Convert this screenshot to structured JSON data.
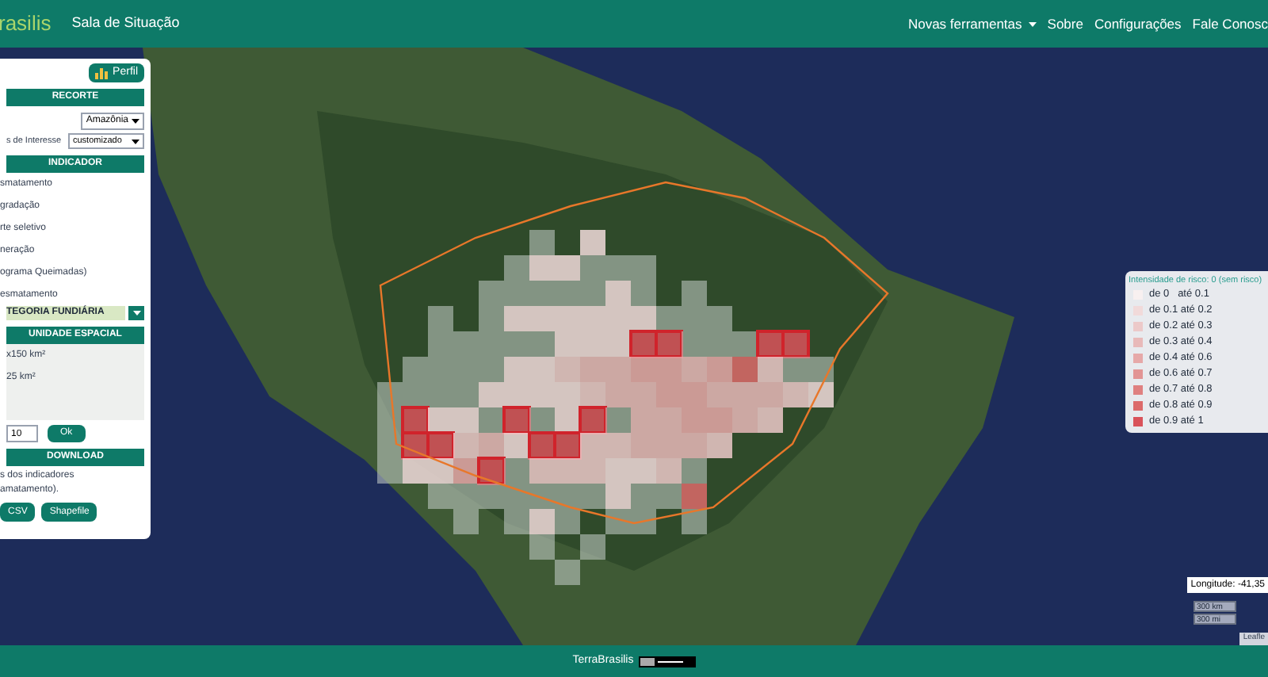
{
  "header": {
    "logo": "rasilis",
    "title": "Sala de Situação",
    "nav": [
      {
        "label": "Novas ferramentas",
        "kind": "dropdown"
      },
      {
        "label": "Sobre",
        "kind": "link"
      },
      {
        "label": "Configurações",
        "kind": "link"
      },
      {
        "label": "Fale Conosc",
        "kind": "link"
      }
    ]
  },
  "panel": {
    "profile_button": "Perfil",
    "sections": [
      {
        "kind": "recorte",
        "title": "RECORTE",
        "region": "Amazônia",
        "interest_label": "s de Interesse",
        "interest_value": "customizado"
      },
      {
        "kind": "indicador",
        "title": "INDICADOR",
        "items": [
          "smatamento",
          "gradação",
          "rte seletivo",
          "neração",
          "ograma Queimadas)",
          "esmatamento"
        ],
        "category": "TEGORIA FUNDIÁRIA"
      },
      {
        "kind": "unidade",
        "title": "UNIDADE ESPACIAL",
        "items": [
          "x150 km²",
          "25 km²"
        ],
        "input_value": "10",
        "ok_button": "Ok"
      },
      {
        "kind": "download",
        "title": "DOWNLOAD",
        "text": "s dos indicadores amatamento).",
        "buttons": [
          "CSV",
          "Shapefile"
        ]
      }
    ]
  },
  "legend": {
    "title": "Intensidade de risco: 0 (sem risco)",
    "items": [
      {
        "label": "de 0   até 0.1",
        "color": "#f8f0f0"
      },
      {
        "label": "de 0.1 até 0.2",
        "color": "#f1dada"
      },
      {
        "label": "de 0.2 até 0.3",
        "color": "#ecc9c9"
      },
      {
        "label": "de 0.3 até 0.4",
        "color": "#e8b9b9"
      },
      {
        "label": "de 0.4 até 0.6",
        "color": "#e6a8a8"
      },
      {
        "label": "de 0.6 até 0.7",
        "color": "#e29494"
      },
      {
        "label": "de 0.7 até 0.8",
        "color": "#df8080"
      },
      {
        "label": "de 0.8 até 0.9",
        "color": "#dc6a6a"
      },
      {
        "label": "de 0.9 até 1",
        "color": "#d9525a"
      }
    ]
  },
  "map": {
    "longitude": "Longitude: -41,35",
    "scale": [
      "300 km",
      "300 mi"
    ],
    "attribution": "Leafle"
  },
  "footer": {
    "text": "TerraBrasilis"
  }
}
